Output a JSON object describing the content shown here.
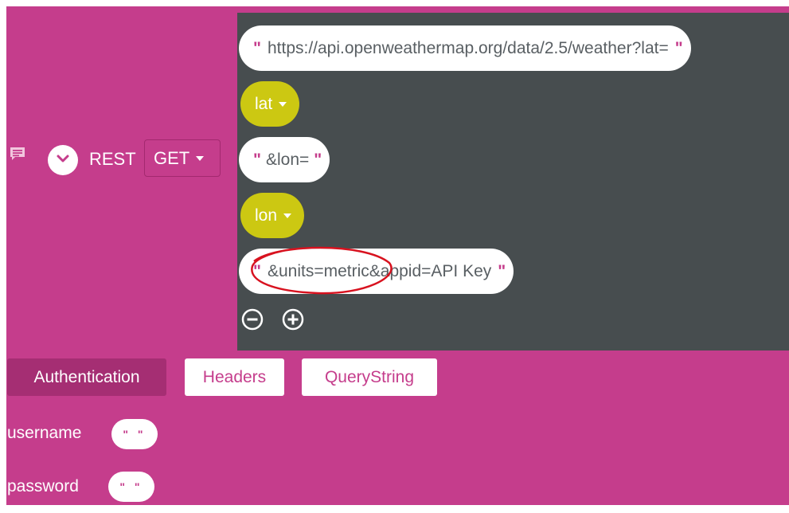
{
  "block": {
    "comment_icon": "comment-icon",
    "collapse_icon": "chevron-down-icon",
    "label": "REST",
    "method": "GET"
  },
  "url_parts": [
    {
      "type": "string",
      "text": "https://api.openweathermap.org/data/2.5/weather?lat="
    },
    {
      "type": "variable",
      "text": "lat"
    },
    {
      "type": "string",
      "text": "&lon="
    },
    {
      "type": "variable",
      "text": "lon"
    },
    {
      "type": "string",
      "text": "&units=metric&appid=API Key"
    }
  ],
  "quote": "\"",
  "mutator": {
    "minus_icon": "minus-circle-icon",
    "plus_icon": "plus-circle-icon"
  },
  "tabs": [
    {
      "label": "Authentication",
      "active": true
    },
    {
      "label": "Headers",
      "active": false
    },
    {
      "label": "QueryString",
      "active": false
    }
  ],
  "auth": {
    "username_label": "username",
    "password_label": "password",
    "empty_string": "\" \""
  },
  "colors": {
    "block": "#c53d8c",
    "inner": "#474d4f",
    "variable": "#ccc812",
    "annotation": "#d8121f"
  }
}
